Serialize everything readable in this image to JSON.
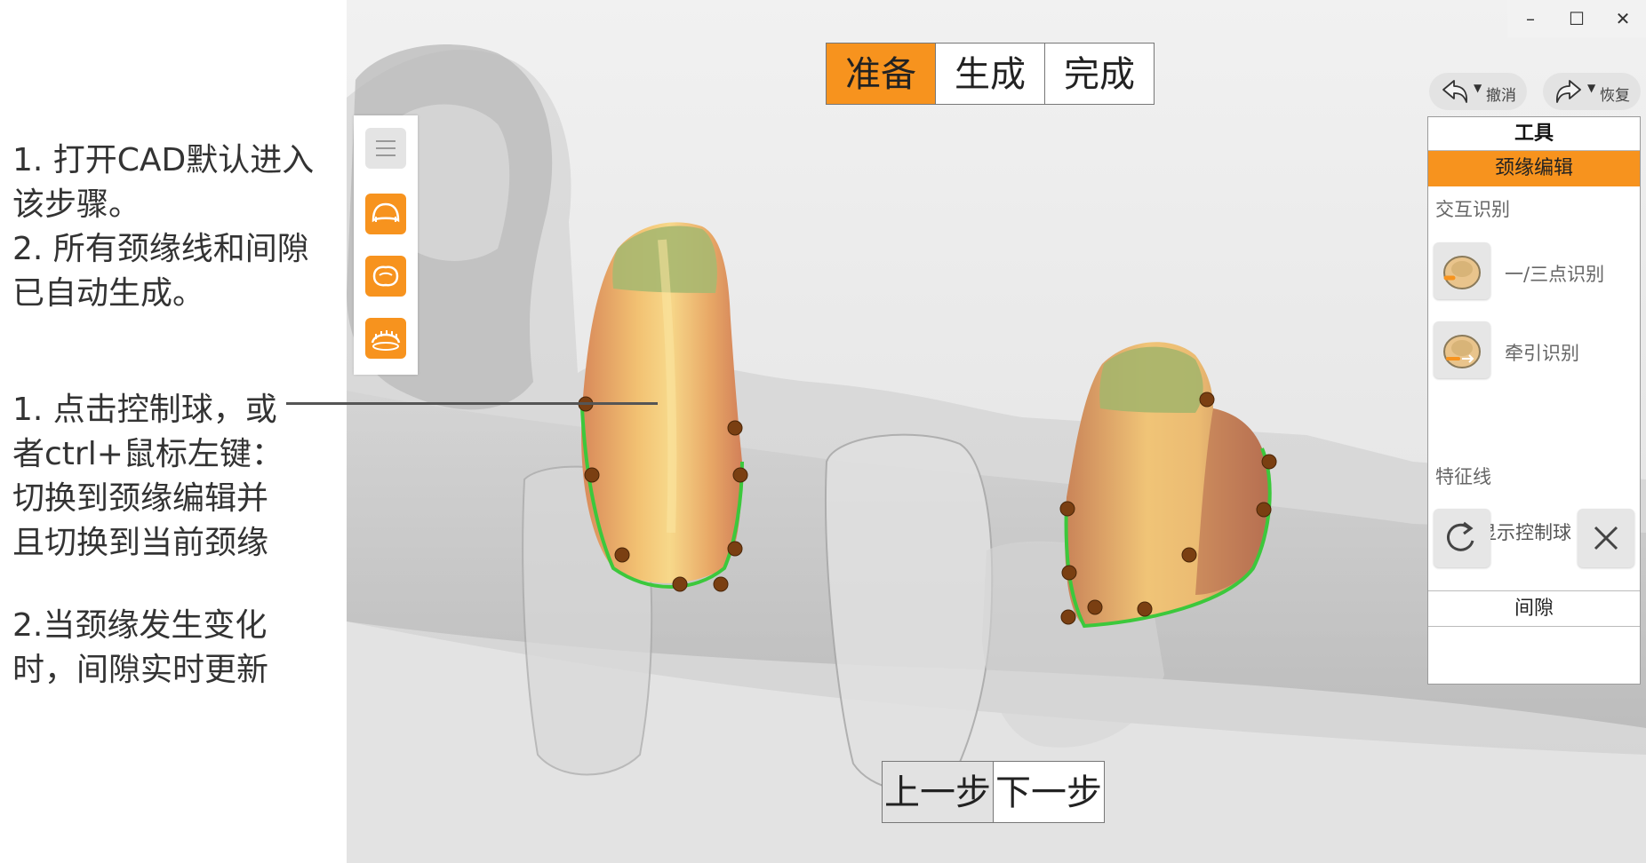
{
  "annotations": {
    "block_a": [
      "1. 打开CAD默认进入",
      "该步骤。",
      "2. 所有颈缘线和间隙",
      "已自动生成。"
    ],
    "block_b": [
      "1. 点击控制球，或",
      "者ctrl+鼠标左键：",
      "切换到颈缘编辑并",
      "且切换到当前颈缘"
    ],
    "block_c": [
      "2.当颈缘发生变化",
      "时，间隙实时更新"
    ]
  },
  "window_controls": {
    "minimize": "–",
    "maximize": "☐",
    "close": "✕"
  },
  "steps": [
    {
      "label": "准备",
      "active": true
    },
    {
      "label": "生成",
      "active": false
    },
    {
      "label": "完成",
      "active": false
    }
  ],
  "left_toolbar": {
    "menu_icon": "hamburger-menu-icon",
    "tools": [
      "crown-arch-icon",
      "occlusal-view-icon",
      "jaw-scan-icon"
    ]
  },
  "undo": {
    "label": "撤消",
    "icon": "undo-arrow-icon"
  },
  "redo": {
    "label": "恢复",
    "icon": "redo-arrow-icon"
  },
  "panel": {
    "title": "工具",
    "section": "颈缘编辑",
    "interactive_label": "交互识别",
    "items": [
      {
        "label": "一/三点识别",
        "icon": "one-three-point-detect-icon"
      },
      {
        "label": "牵引识别",
        "icon": "traction-detect-icon"
      }
    ],
    "toggle_label": "显示控制球",
    "toggle_on": false,
    "feature_label": "特征线",
    "gap_label": "间隙"
  },
  "bottom_nav": {
    "prev": "上一步",
    "next": "下一步"
  },
  "colors": {
    "accent": "#f7931e",
    "margin_line": "#3cc83c",
    "control_ball": "#7a3f12"
  }
}
